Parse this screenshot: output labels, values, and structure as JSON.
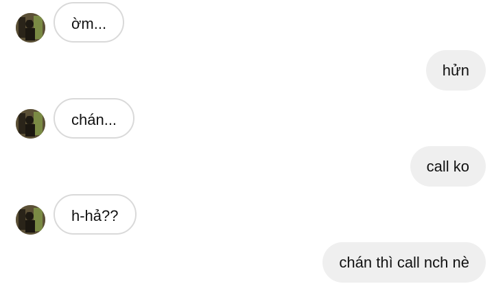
{
  "conversation": {
    "messages": [
      {
        "direction": "incoming",
        "text": "ờm..."
      },
      {
        "direction": "outgoing",
        "text": "hửn"
      },
      {
        "direction": "incoming",
        "text": "chán..."
      },
      {
        "direction": "outgoing",
        "text": "call ko"
      },
      {
        "direction": "incoming",
        "text": "h-hả??"
      },
      {
        "direction": "outgoing",
        "text": "chán thì call nch nè"
      }
    ]
  },
  "colors": {
    "incoming_bubble_border": "#d9d9d9",
    "outgoing_bubble_bg": "#efefef",
    "text": "#111111"
  },
  "icons": {
    "avatar": "contact-avatar"
  }
}
